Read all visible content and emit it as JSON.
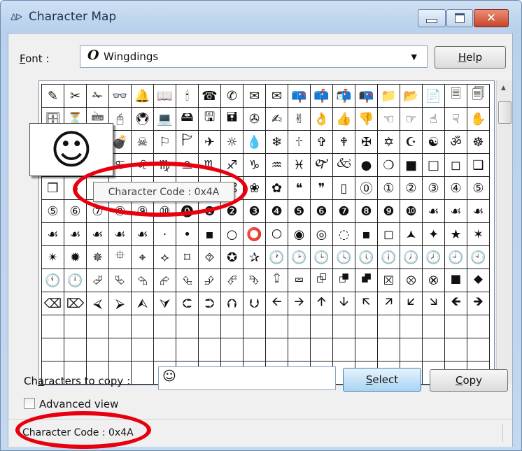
{
  "window": {
    "title": "Character Map",
    "app_icon": "ᐃᐅ",
    "controls": {
      "minimize": "minimize",
      "maximize": "maximize",
      "close": "✕"
    }
  },
  "font": {
    "label": "Font :",
    "label_mnemonic_char": "F",
    "glyph": "O",
    "value": "Wingdings"
  },
  "help_button": {
    "label": "Help",
    "mnemonic_char": "H"
  },
  "grid": {
    "columns": 20,
    "rows": [
      [
        "✎",
        "✂",
        "✁",
        "👓",
        "🔔",
        "📖",
        "🕯",
        "☎",
        "✆",
        "✉",
        "✉",
        "📪",
        "📫",
        "📬",
        "📭",
        "📁",
        "📂",
        "📄",
        "🗏",
        "🗐"
      ],
      [
        "🗄",
        "⏳",
        "🖮",
        "🖰",
        "🖲",
        "💻",
        "🖴",
        "🖫",
        "🖬",
        "✇",
        "✍",
        "✌",
        "👌",
        "👍",
        "👎",
        "☜",
        "☞",
        "☝",
        "☟",
        "✋"
      ],
      [
        "☺",
        "😐",
        "☹",
        "💣",
        "☠",
        "⚐",
        "🏱",
        "✈",
        "☼",
        "💧",
        "❄",
        "🕆",
        "✞",
        "🕈",
        "✠",
        "✡",
        "☪",
        "☯",
        "ॐ",
        "☸"
      ],
      [
        "♈",
        "♉",
        "♊",
        "♋",
        "♌",
        "♍",
        "♎",
        "♏",
        "♐",
        "♑",
        "♒",
        "♓",
        "🙰",
        "🙵",
        "●",
        "❍",
        "■",
        "□",
        "◻",
        "❑"
      ],
      [
        "❒",
        "⬧",
        "⧫",
        "◆",
        "❖",
        "⬥",
        "⌧",
        "⍓",
        "⌘",
        "❀",
        "✿",
        "❝",
        "❞",
        "▯",
        "⓪",
        "①",
        "②",
        "③",
        "④",
        "⑤"
      ],
      [
        "⑤",
        "⑥",
        "⑦",
        "⑧",
        "⑨",
        "⑩",
        "⓿",
        "❶",
        "❷",
        "❸",
        "❹",
        "❺",
        "❻",
        "❼",
        "❽",
        "❾",
        "❿",
        "☙",
        "☙",
        "☙"
      ],
      [
        "☙",
        "☙",
        "☙",
        "☙",
        "☙",
        "·",
        "•",
        "▪",
        "○",
        "⭕",
        "🞅",
        "◉",
        "◎",
        "◌",
        "▪",
        "◻",
        "🟂",
        "✦",
        "★",
        "✶"
      ],
      [
        "✴",
        "✹",
        "✵",
        "⯐",
        "⌖",
        "⟡",
        "⌑",
        "⯑",
        "✪",
        "✰",
        "🕐",
        "🕑",
        "🕒",
        "🕓",
        "🕔",
        "🕕",
        "🕖",
        "🕗",
        "🕘",
        "🕙"
      ],
      [
        "🕚",
        "🕛",
        "⮰",
        "⮱",
        "⮲",
        "⮳",
        "⮴",
        "⮵",
        "⮶",
        "⮷",
        "⮸",
        "⮹",
        "⮺",
        "⮻",
        "⮼",
        "⮽",
        "⮾",
        "⮿",
        "⯀",
        "⯁"
      ],
      [
        "⌫",
        "⌦",
        "⮘",
        "⮚",
        "⮙",
        "⮛",
        "⮈",
        "⮊",
        "⮉",
        "⮋",
        "🡨",
        "🡪",
        "🡩",
        "🡫",
        "🡬",
        "🡭",
        "🡯",
        "🡮",
        "🡸",
        "🡺"
      ],
      [
        "",
        "",
        "",
        "",
        "",
        "",
        "",
        "",
        "",
        "",
        "",
        "",
        "",
        "",
        "",
        "",
        "",
        "",
        "",
        ""
      ],
      [
        "",
        "",
        "",
        "",
        "",
        "",
        "",
        "",
        "",
        "",
        "",
        "",
        "",
        "",
        "",
        "",
        "",
        "",
        "",
        ""
      ],
      [
        "",
        "",
        "",
        "",
        "",
        "",
        "",
        "",
        "",
        "",
        "",
        "",
        "",
        "",
        "",
        "",
        "",
        "",
        "",
        ""
      ]
    ]
  },
  "magnifier": {
    "glyph": "☺"
  },
  "tooltip": {
    "text": "Character Code : 0x4A"
  },
  "characters_to_copy": {
    "label": "Characters to copy :",
    "value": "☺"
  },
  "select_button": {
    "label": "Select",
    "mnemonic_char": "S"
  },
  "copy_button": {
    "label": "Copy",
    "mnemonic_char": "C"
  },
  "advanced_view": {
    "label": "Advanced view",
    "checked": false
  },
  "statusbar": {
    "text": "Character Code : 0x4A"
  },
  "colors": {
    "highlight": "#e8000e",
    "title_bar": "#c4d8ef",
    "select_button": "#a9d4f3"
  }
}
